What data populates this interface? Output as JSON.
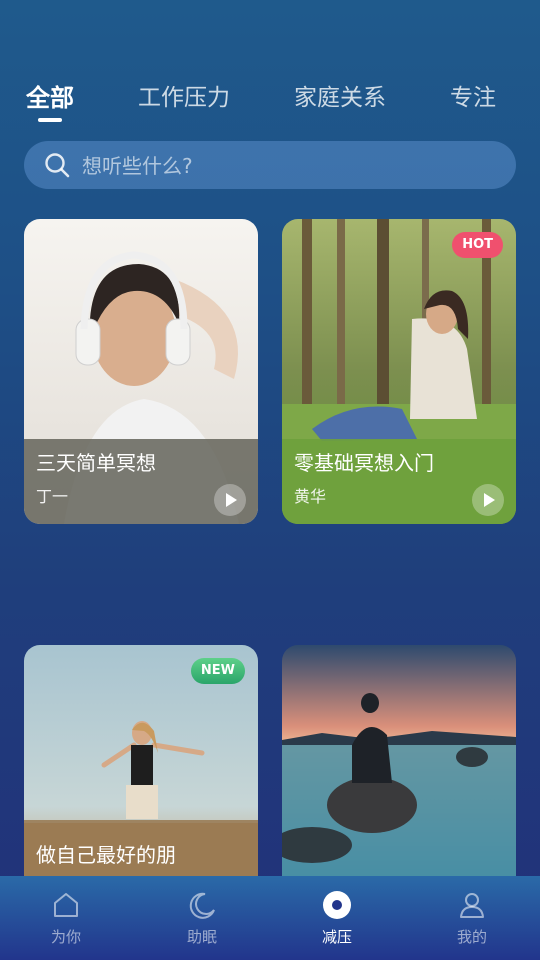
{
  "tabs": [
    {
      "label": "全部",
      "active": true
    },
    {
      "label": "工作压力",
      "active": false
    },
    {
      "label": "家庭关系",
      "active": false
    },
    {
      "label": "专注",
      "active": false
    }
  ],
  "search": {
    "placeholder": "想听些什么?",
    "icon": "search-icon"
  },
  "cards": [
    {
      "title": "三天简单冥想",
      "author": "丁一",
      "badge": "",
      "image": "man-with-headphones-relaxing"
    },
    {
      "title": "零基础冥想入门",
      "author": "黄华",
      "badge": "HOT",
      "image": "woman-sitting-in-forest"
    },
    {
      "title": "做自己最好的朋",
      "author": "",
      "badge": "NEW",
      "image": "woman-arms-open-on-beach"
    },
    {
      "title": "",
      "author": "",
      "badge": "",
      "image": "man-sitting-on-rock-sunset"
    }
  ],
  "tabbar": [
    {
      "label": "为你",
      "icon": "home-icon",
      "active": false
    },
    {
      "label": "助眠",
      "icon": "moon-icon",
      "active": false
    },
    {
      "label": "减压",
      "icon": "record-icon",
      "active": true
    },
    {
      "label": "我的",
      "icon": "user-icon",
      "active": false
    }
  ],
  "colors": {
    "hot_badge": "#f0506e",
    "new_badge": "#2aa56a",
    "background": "#1f4f86"
  }
}
